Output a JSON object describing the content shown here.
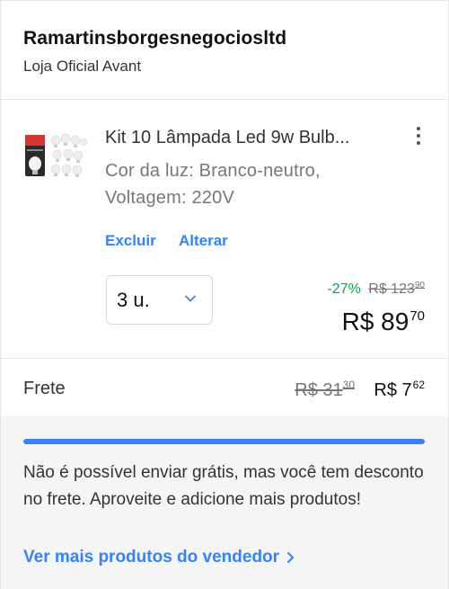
{
  "seller": {
    "name": "Ramartinsborgesnegociosltd",
    "subtitle": "Loja Oficial Avant"
  },
  "product": {
    "title": "Kit 10 Lâmpada Led 9w Bulb...",
    "color_attr": "Cor da luz: Branco-neutro,",
    "voltage_attr": "Voltagem: 220V",
    "actions": {
      "delete": "Excluir",
      "change": "Alterar"
    },
    "quantity": "3 u.",
    "discount_pct": "-27%",
    "old_price_int": "R$ 123",
    "old_price_cents": "90",
    "price_int": "R$ 89",
    "price_cents": "70",
    "thumbnail_icon": "led-bulb-kit-image"
  },
  "shipping": {
    "label": "Frete",
    "old_int": "R$ 31",
    "old_cents": "30",
    "new_int": "R$ 7",
    "new_cents": "62"
  },
  "info": {
    "progress": 1.0,
    "message": "Não é possível enviar grátis, mas você tem desconto no frete. Aproveite e adicione mais produtos!",
    "link": "Ver mais produtos do vendedor"
  },
  "colors": {
    "accent": "#3483fa",
    "discount": "#00a650"
  }
}
